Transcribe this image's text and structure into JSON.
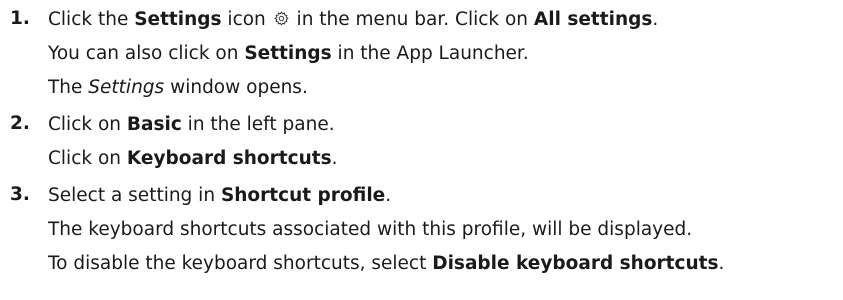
{
  "steps": [
    {
      "number": "1.",
      "lines": {
        "l1": {
          "t1": "Click the ",
          "b1": "Settings",
          "t2": " icon ",
          "t3": " in the menu bar. Click on ",
          "b2": "All settings",
          "t4": "."
        },
        "l2": {
          "t1": "You can also click on ",
          "b1": "Settings",
          "t2": " in the App Launcher."
        },
        "l3": {
          "t1": "The ",
          "i1": "Settings",
          "t2": " window opens."
        }
      },
      "icon": "gear-icon"
    },
    {
      "number": "2.",
      "lines": {
        "l1": {
          "t1": "Click on ",
          "b1": "Basic",
          "t2": " in the left pane."
        },
        "l2": {
          "t1": "Click on ",
          "b1": "Keyboard shortcuts",
          "t2": "."
        }
      }
    },
    {
      "number": "3.",
      "lines": {
        "l1": {
          "t1": "Select a setting in ",
          "b1": "Shortcut profile",
          "t2": "."
        },
        "l2": {
          "t1": "The keyboard shortcuts associated with this profile, will be displayed."
        },
        "l3": {
          "t1": "To disable the keyboard shortcuts, select ",
          "b1": "Disable keyboard shortcuts",
          "t2": "."
        }
      }
    }
  ]
}
